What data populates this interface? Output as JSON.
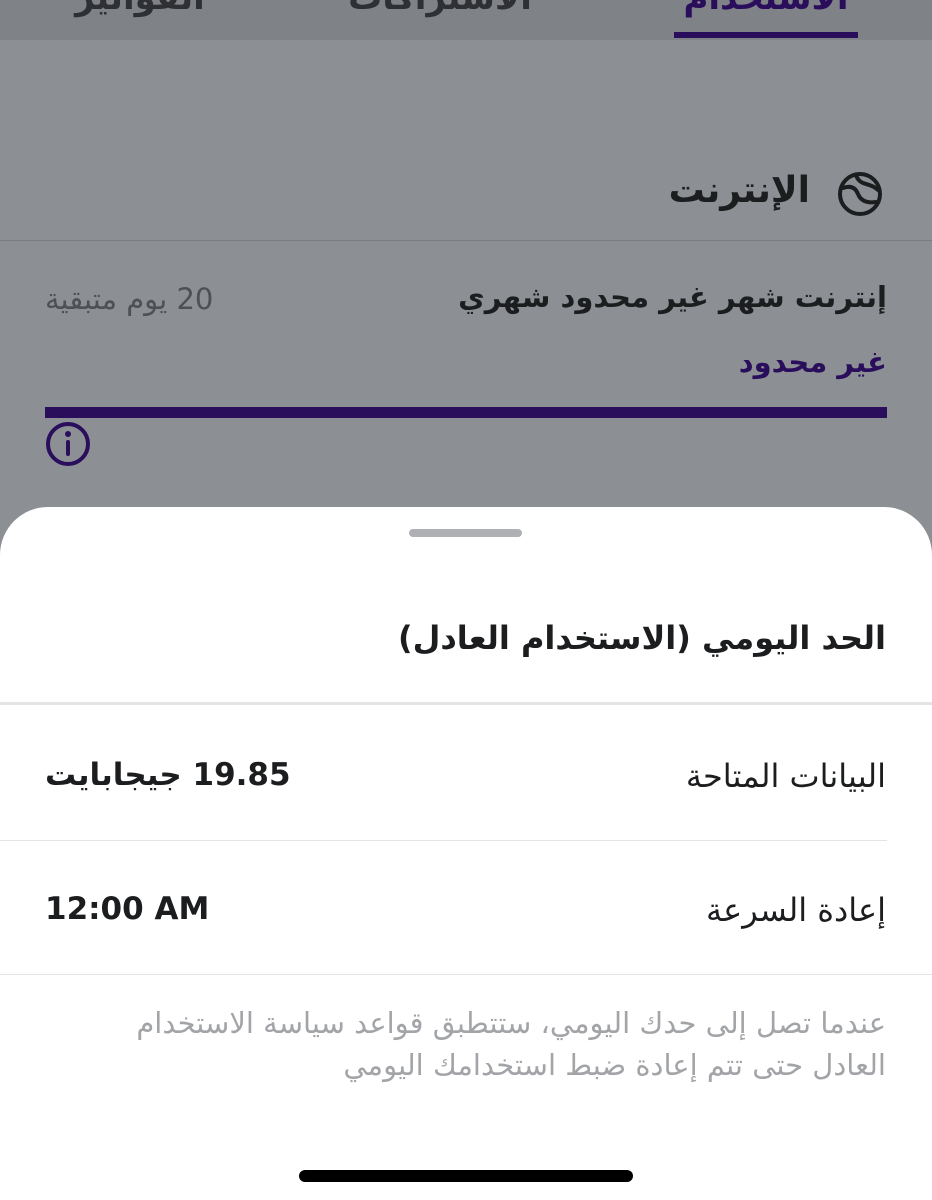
{
  "tabs": [
    {
      "label": "الاستخدام",
      "active": true
    },
    {
      "label": "الاشتراكات",
      "active": false
    },
    {
      "label": "الفواتير",
      "active": false
    }
  ],
  "section": {
    "title": "الإنترنت",
    "icon": "globe-icon"
  },
  "plan": {
    "name": "إنترنت شهر غير محدود شهري",
    "remaining": "20 يوم متبقية",
    "allowance": "غير محدود",
    "usage_fraction": 1.0,
    "info_icon": "info-icon"
  },
  "sheet": {
    "title": "الحد اليومي (الاستخدام العادل)",
    "rows": [
      {
        "label": "البيانات المتاحة",
        "value": "19.85 جيجابايت"
      },
      {
        "label": "إعادة السرعة",
        "value": "12:00 AM"
      }
    ],
    "note": "عندما تصل إلى حدك اليومي، ستتطبق قواعد سياسة الاستخدام العادل حتى تتم إعادة ضبط استخدامك اليومي"
  },
  "colors": {
    "accent": "#2a0e5c",
    "overlay": "#8c8f93",
    "sheet_bg": "#ffffff",
    "muted_text": "#a2a4a8"
  }
}
